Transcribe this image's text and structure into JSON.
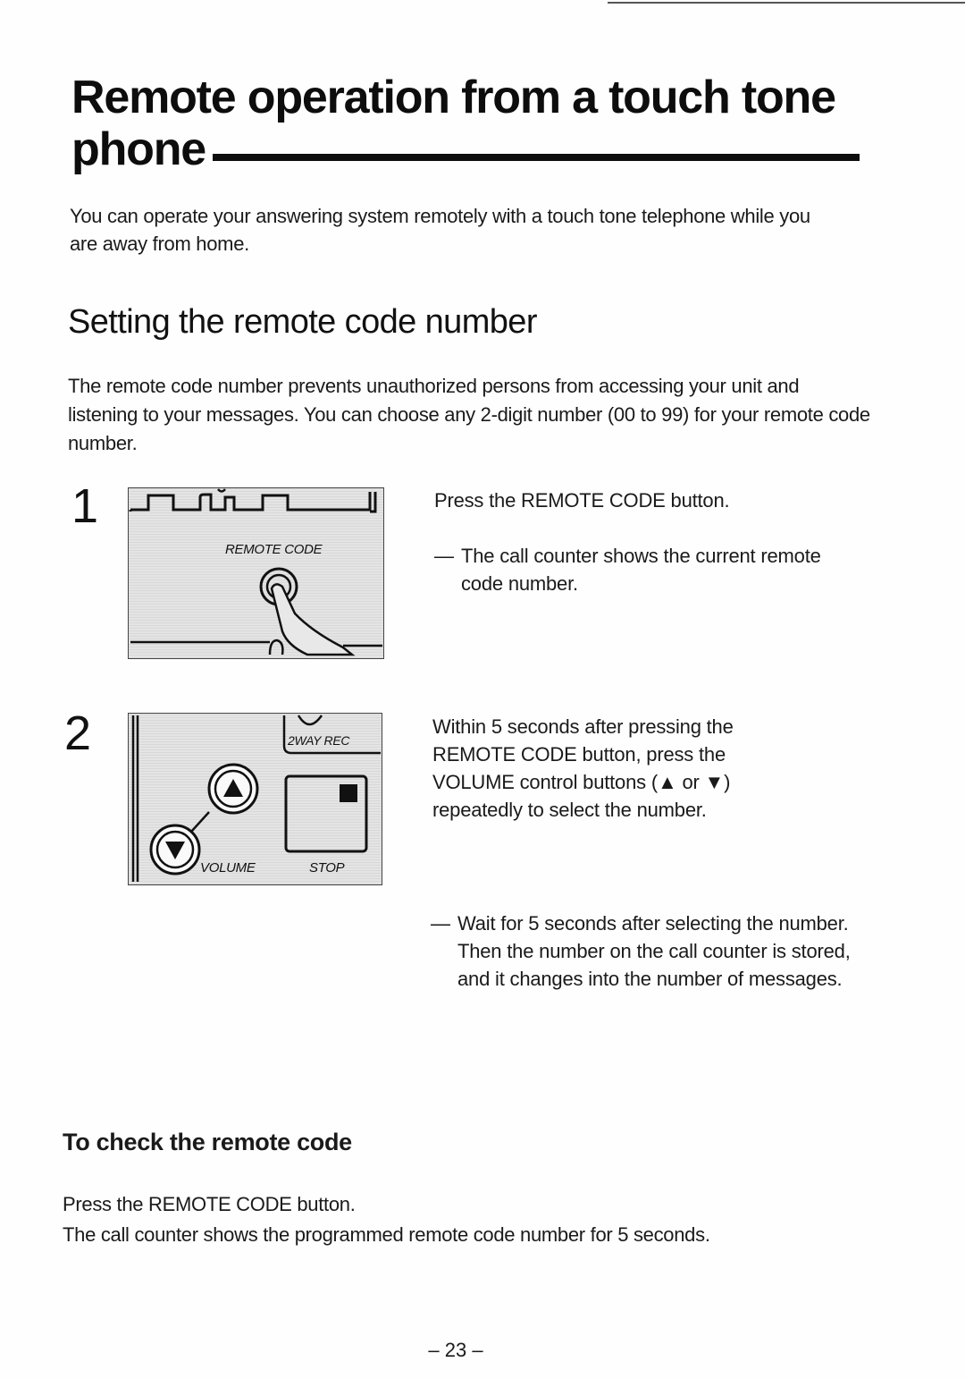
{
  "page": {
    "title": "Remote operation from a touch tone phone",
    "intro": "You can operate your answering system remotely with a touch tone telephone while you are away from home.",
    "section_heading": "Setting the remote code number",
    "section_paragraph": "The remote code number prevents unauthorized persons from accessing your unit and listening to your messages. You can choose any 2-digit number (00 to 99) for your remote code number.",
    "page_number": "– 23 –"
  },
  "steps": [
    {
      "number": "1",
      "illustration": {
        "label": "REMOTE CODE",
        "icons": [
          "remote-code-button",
          "pressing-finger"
        ]
      },
      "instruction": "Press the REMOTE CODE button.",
      "notes": [
        {
          "dash": "—",
          "text": "The call counter shows the current remote code number."
        }
      ]
    },
    {
      "number": "2",
      "illustration": {
        "labels": {
          "rec": "2WAY REC",
          "volume": "VOLUME",
          "stop": "STOP"
        },
        "icons": [
          "volume-up-button",
          "volume-down-button",
          "stop-button"
        ]
      },
      "instruction": "Within 5 seconds after pressing the REMOTE CODE button, press the VOLUME control buttons (▲ or ▼) repeatedly to select the number.",
      "notes": [
        {
          "dash": "—",
          "text": "Wait for 5 seconds after selecting the number.",
          "text2": "Then the number on the call counter is stored, and it changes into the number of messages."
        }
      ]
    }
  ],
  "check": {
    "heading": "To check the remote code",
    "line1": "Press the REMOTE CODE button.",
    "line2": "The call counter shows the programmed remote code number for 5 seconds."
  }
}
